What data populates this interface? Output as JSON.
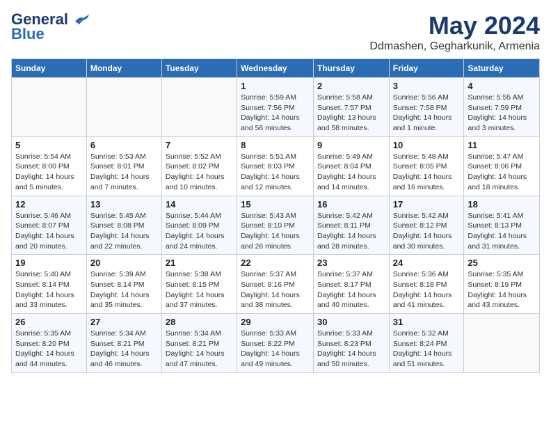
{
  "header": {
    "logo_line1": "General",
    "logo_line2": "Blue",
    "title": "May 2024",
    "subtitle": "Ddmashen, Gegharkunik, Armenia"
  },
  "weekdays": [
    "Sunday",
    "Monday",
    "Tuesday",
    "Wednesday",
    "Thursday",
    "Friday",
    "Saturday"
  ],
  "rows": [
    [
      {
        "day": "",
        "sunrise": "",
        "sunset": "",
        "daylight": ""
      },
      {
        "day": "",
        "sunrise": "",
        "sunset": "",
        "daylight": ""
      },
      {
        "day": "",
        "sunrise": "",
        "sunset": "",
        "daylight": ""
      },
      {
        "day": "1",
        "sunrise": "Sunrise: 5:59 AM",
        "sunset": "Sunset: 7:56 PM",
        "daylight": "Daylight: 14 hours and 56 minutes."
      },
      {
        "day": "2",
        "sunrise": "Sunrise: 5:58 AM",
        "sunset": "Sunset: 7:57 PM",
        "daylight": "Daylight: 13 hours and 58 minutes."
      },
      {
        "day": "3",
        "sunrise": "Sunrise: 5:56 AM",
        "sunset": "Sunset: 7:58 PM",
        "daylight": "Daylight: 14 hours and 1 minute."
      },
      {
        "day": "4",
        "sunrise": "Sunrise: 5:55 AM",
        "sunset": "Sunset: 7:59 PM",
        "daylight": "Daylight: 14 hours and 3 minutes."
      }
    ],
    [
      {
        "day": "5",
        "sunrise": "Sunrise: 5:54 AM",
        "sunset": "Sunset: 8:00 PM",
        "daylight": "Daylight: 14 hours and 5 minutes."
      },
      {
        "day": "6",
        "sunrise": "Sunrise: 5:53 AM",
        "sunset": "Sunset: 8:01 PM",
        "daylight": "Daylight: 14 hours and 7 minutes."
      },
      {
        "day": "7",
        "sunrise": "Sunrise: 5:52 AM",
        "sunset": "Sunset: 8:02 PM",
        "daylight": "Daylight: 14 hours and 10 minutes."
      },
      {
        "day": "8",
        "sunrise": "Sunrise: 5:51 AM",
        "sunset": "Sunset: 8:03 PM",
        "daylight": "Daylight: 14 hours and 12 minutes."
      },
      {
        "day": "9",
        "sunrise": "Sunrise: 5:49 AM",
        "sunset": "Sunset: 8:04 PM",
        "daylight": "Daylight: 14 hours and 14 minutes."
      },
      {
        "day": "10",
        "sunrise": "Sunrise: 5:48 AM",
        "sunset": "Sunset: 8:05 PM",
        "daylight": "Daylight: 14 hours and 16 minutes."
      },
      {
        "day": "11",
        "sunrise": "Sunrise: 5:47 AM",
        "sunset": "Sunset: 8:06 PM",
        "daylight": "Daylight: 14 hours and 18 minutes."
      }
    ],
    [
      {
        "day": "12",
        "sunrise": "Sunrise: 5:46 AM",
        "sunset": "Sunset: 8:07 PM",
        "daylight": "Daylight: 14 hours and 20 minutes."
      },
      {
        "day": "13",
        "sunrise": "Sunrise: 5:45 AM",
        "sunset": "Sunset: 8:08 PM",
        "daylight": "Daylight: 14 hours and 22 minutes."
      },
      {
        "day": "14",
        "sunrise": "Sunrise: 5:44 AM",
        "sunset": "Sunset: 8:09 PM",
        "daylight": "Daylight: 14 hours and 24 minutes."
      },
      {
        "day": "15",
        "sunrise": "Sunrise: 5:43 AM",
        "sunset": "Sunset: 8:10 PM",
        "daylight": "Daylight: 14 hours and 26 minutes."
      },
      {
        "day": "16",
        "sunrise": "Sunrise: 5:42 AM",
        "sunset": "Sunset: 8:11 PM",
        "daylight": "Daylight: 14 hours and 28 minutes."
      },
      {
        "day": "17",
        "sunrise": "Sunrise: 5:42 AM",
        "sunset": "Sunset: 8:12 PM",
        "daylight": "Daylight: 14 hours and 30 minutes."
      },
      {
        "day": "18",
        "sunrise": "Sunrise: 5:41 AM",
        "sunset": "Sunset: 8:13 PM",
        "daylight": "Daylight: 14 hours and 31 minutes."
      }
    ],
    [
      {
        "day": "19",
        "sunrise": "Sunrise: 5:40 AM",
        "sunset": "Sunset: 8:14 PM",
        "daylight": "Daylight: 14 hours and 33 minutes."
      },
      {
        "day": "20",
        "sunrise": "Sunrise: 5:39 AM",
        "sunset": "Sunset: 8:14 PM",
        "daylight": "Daylight: 14 hours and 35 minutes."
      },
      {
        "day": "21",
        "sunrise": "Sunrise: 5:38 AM",
        "sunset": "Sunset: 8:15 PM",
        "daylight": "Daylight: 14 hours and 37 minutes."
      },
      {
        "day": "22",
        "sunrise": "Sunrise: 5:37 AM",
        "sunset": "Sunset: 8:16 PM",
        "daylight": "Daylight: 14 hours and 38 minutes."
      },
      {
        "day": "23",
        "sunrise": "Sunrise: 5:37 AM",
        "sunset": "Sunset: 8:17 PM",
        "daylight": "Daylight: 14 hours and 40 minutes."
      },
      {
        "day": "24",
        "sunrise": "Sunrise: 5:36 AM",
        "sunset": "Sunset: 8:18 PM",
        "daylight": "Daylight: 14 hours and 41 minutes."
      },
      {
        "day": "25",
        "sunrise": "Sunrise: 5:35 AM",
        "sunset": "Sunset: 8:19 PM",
        "daylight": "Daylight: 14 hours and 43 minutes."
      }
    ],
    [
      {
        "day": "26",
        "sunrise": "Sunrise: 5:35 AM",
        "sunset": "Sunset: 8:20 PM",
        "daylight": "Daylight: 14 hours and 44 minutes."
      },
      {
        "day": "27",
        "sunrise": "Sunrise: 5:34 AM",
        "sunset": "Sunset: 8:21 PM",
        "daylight": "Daylight: 14 hours and 46 minutes."
      },
      {
        "day": "28",
        "sunrise": "Sunrise: 5:34 AM",
        "sunset": "Sunset: 8:21 PM",
        "daylight": "Daylight: 14 hours and 47 minutes."
      },
      {
        "day": "29",
        "sunrise": "Sunrise: 5:33 AM",
        "sunset": "Sunset: 8:22 PM",
        "daylight": "Daylight: 14 hours and 49 minutes."
      },
      {
        "day": "30",
        "sunrise": "Sunrise: 5:33 AM",
        "sunset": "Sunset: 8:23 PM",
        "daylight": "Daylight: 14 hours and 50 minutes."
      },
      {
        "day": "31",
        "sunrise": "Sunrise: 5:32 AM",
        "sunset": "Sunset: 8:24 PM",
        "daylight": "Daylight: 14 hours and 51 minutes."
      },
      {
        "day": "",
        "sunrise": "",
        "sunset": "",
        "daylight": ""
      }
    ]
  ]
}
